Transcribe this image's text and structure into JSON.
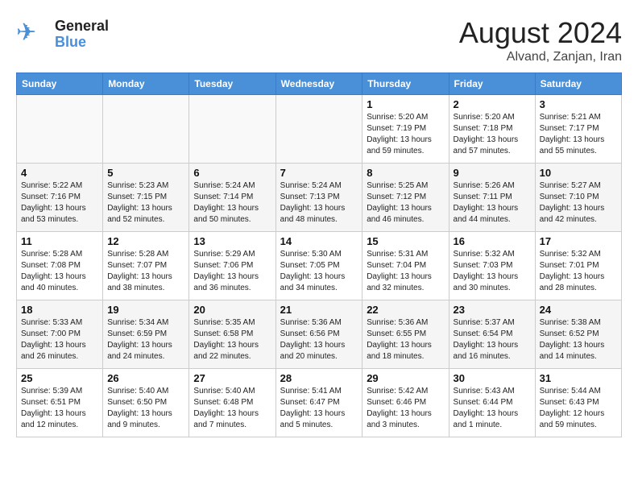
{
  "header": {
    "logo_general": "General",
    "logo_blue": "Blue",
    "month_year": "August 2024",
    "location": "Alvand, Zanjan, Iran"
  },
  "days_of_week": [
    "Sunday",
    "Monday",
    "Tuesday",
    "Wednesday",
    "Thursday",
    "Friday",
    "Saturday"
  ],
  "weeks": [
    {
      "days": [
        {
          "number": "",
          "empty": true
        },
        {
          "number": "",
          "empty": true
        },
        {
          "number": "",
          "empty": true
        },
        {
          "number": "",
          "empty": true
        },
        {
          "number": "1",
          "sunrise": "5:20 AM",
          "sunset": "7:19 PM",
          "daylight": "13 hours and 59 minutes."
        },
        {
          "number": "2",
          "sunrise": "5:20 AM",
          "sunset": "7:18 PM",
          "daylight": "13 hours and 57 minutes."
        },
        {
          "number": "3",
          "sunrise": "5:21 AM",
          "sunset": "7:17 PM",
          "daylight": "13 hours and 55 minutes."
        }
      ]
    },
    {
      "days": [
        {
          "number": "4",
          "sunrise": "5:22 AM",
          "sunset": "7:16 PM",
          "daylight": "13 hours and 53 minutes."
        },
        {
          "number": "5",
          "sunrise": "5:23 AM",
          "sunset": "7:15 PM",
          "daylight": "13 hours and 52 minutes."
        },
        {
          "number": "6",
          "sunrise": "5:24 AM",
          "sunset": "7:14 PM",
          "daylight": "13 hours and 50 minutes."
        },
        {
          "number": "7",
          "sunrise": "5:24 AM",
          "sunset": "7:13 PM",
          "daylight": "13 hours and 48 minutes."
        },
        {
          "number": "8",
          "sunrise": "5:25 AM",
          "sunset": "7:12 PM",
          "daylight": "13 hours and 46 minutes."
        },
        {
          "number": "9",
          "sunrise": "5:26 AM",
          "sunset": "7:11 PM",
          "daylight": "13 hours and 44 minutes."
        },
        {
          "number": "10",
          "sunrise": "5:27 AM",
          "sunset": "7:10 PM",
          "daylight": "13 hours and 42 minutes."
        }
      ]
    },
    {
      "days": [
        {
          "number": "11",
          "sunrise": "5:28 AM",
          "sunset": "7:08 PM",
          "daylight": "13 hours and 40 minutes."
        },
        {
          "number": "12",
          "sunrise": "5:28 AM",
          "sunset": "7:07 PM",
          "daylight": "13 hours and 38 minutes."
        },
        {
          "number": "13",
          "sunrise": "5:29 AM",
          "sunset": "7:06 PM",
          "daylight": "13 hours and 36 minutes."
        },
        {
          "number": "14",
          "sunrise": "5:30 AM",
          "sunset": "7:05 PM",
          "daylight": "13 hours and 34 minutes."
        },
        {
          "number": "15",
          "sunrise": "5:31 AM",
          "sunset": "7:04 PM",
          "daylight": "13 hours and 32 minutes."
        },
        {
          "number": "16",
          "sunrise": "5:32 AM",
          "sunset": "7:03 PM",
          "daylight": "13 hours and 30 minutes."
        },
        {
          "number": "17",
          "sunrise": "5:32 AM",
          "sunset": "7:01 PM",
          "daylight": "13 hours and 28 minutes."
        }
      ]
    },
    {
      "days": [
        {
          "number": "18",
          "sunrise": "5:33 AM",
          "sunset": "7:00 PM",
          "daylight": "13 hours and 26 minutes."
        },
        {
          "number": "19",
          "sunrise": "5:34 AM",
          "sunset": "6:59 PM",
          "daylight": "13 hours and 24 minutes."
        },
        {
          "number": "20",
          "sunrise": "5:35 AM",
          "sunset": "6:58 PM",
          "daylight": "13 hours and 22 minutes."
        },
        {
          "number": "21",
          "sunrise": "5:36 AM",
          "sunset": "6:56 PM",
          "daylight": "13 hours and 20 minutes."
        },
        {
          "number": "22",
          "sunrise": "5:36 AM",
          "sunset": "6:55 PM",
          "daylight": "13 hours and 18 minutes."
        },
        {
          "number": "23",
          "sunrise": "5:37 AM",
          "sunset": "6:54 PM",
          "daylight": "13 hours and 16 minutes."
        },
        {
          "number": "24",
          "sunrise": "5:38 AM",
          "sunset": "6:52 PM",
          "daylight": "13 hours and 14 minutes."
        }
      ]
    },
    {
      "days": [
        {
          "number": "25",
          "sunrise": "5:39 AM",
          "sunset": "6:51 PM",
          "daylight": "13 hours and 12 minutes."
        },
        {
          "number": "26",
          "sunrise": "5:40 AM",
          "sunset": "6:50 PM",
          "daylight": "13 hours and 9 minutes."
        },
        {
          "number": "27",
          "sunrise": "5:40 AM",
          "sunset": "6:48 PM",
          "daylight": "13 hours and 7 minutes."
        },
        {
          "number": "28",
          "sunrise": "5:41 AM",
          "sunset": "6:47 PM",
          "daylight": "13 hours and 5 minutes."
        },
        {
          "number": "29",
          "sunrise": "5:42 AM",
          "sunset": "6:46 PM",
          "daylight": "13 hours and 3 minutes."
        },
        {
          "number": "30",
          "sunrise": "5:43 AM",
          "sunset": "6:44 PM",
          "daylight": "13 hours and 1 minute."
        },
        {
          "number": "31",
          "sunrise": "5:44 AM",
          "sunset": "6:43 PM",
          "daylight": "12 hours and 59 minutes."
        }
      ]
    }
  ]
}
